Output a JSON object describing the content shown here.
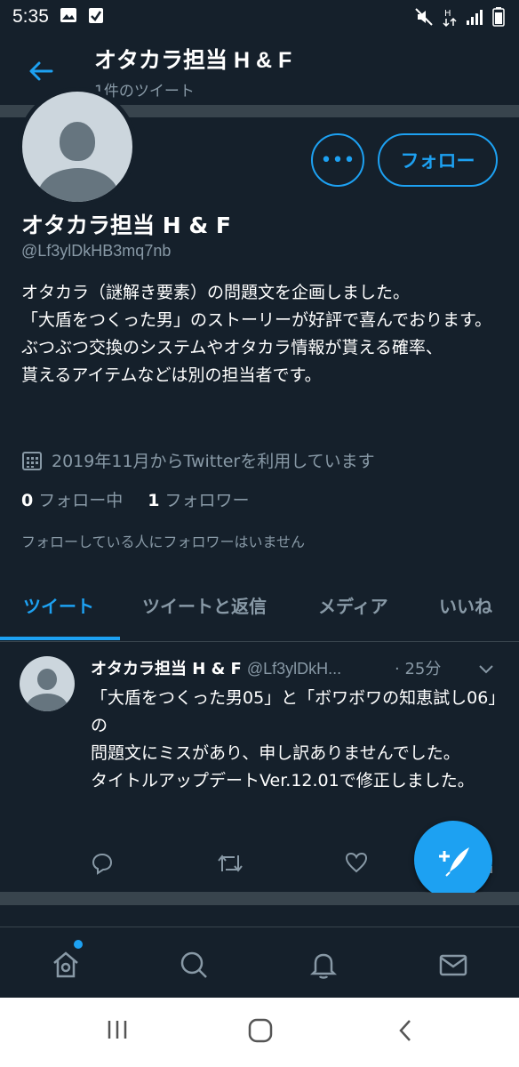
{
  "status_bar": {
    "time": "5:35"
  },
  "header": {
    "title": "オタカラ担当 H & F",
    "subtitle": "1件のツイート"
  },
  "profile": {
    "name": "オタカラ担当 H & F",
    "handle": "@Lf3ylDkHB3mq7nb",
    "bio": "オタカラ（謎解き要素）の問題文を企画しました。\n「大盾をつくった男」のストーリーが好評で喜んでおります。\nぶつぶつ交換のシステムやオタカラ情報が貰える確率、\n貰えるアイテムなどは別の担当者です。",
    "joined": "2019年11月からTwitterを利用しています",
    "following_count": "0",
    "following_label": "フォロー中",
    "followers_count": "1",
    "followers_label": "フォロワー",
    "no_followers_note": "フォローしている人にフォロワーはいません",
    "follow_label": "フォロー",
    "more_label": "•••"
  },
  "tabs": [
    {
      "label": "ツイート",
      "active": true
    },
    {
      "label": "ツイートと返信",
      "active": false
    },
    {
      "label": "メディア",
      "active": false
    },
    {
      "label": "いいね",
      "active": false
    }
  ],
  "tweet": {
    "name": "オタカラ担当 H & F",
    "handle": "@Lf3ylDkH...",
    "time": "· 25分",
    "text": "「大盾をつくった男05」と「ボワボワの知恵試し06」の\n問題文にミスがあり、申し訳ありませんでした。\nタイトルアップデートVer.12.01で修正しました。"
  },
  "colors": {
    "background": "#15202b",
    "accent": "#1da1f2",
    "muted": "#8899a6",
    "divider": "#38444d"
  },
  "icons": [
    "back-arrow-icon",
    "calendar-icon",
    "reply-icon",
    "retweet-icon",
    "like-icon",
    "share-icon",
    "compose-icon",
    "home-icon",
    "search-icon",
    "bell-icon",
    "mail-icon"
  ]
}
